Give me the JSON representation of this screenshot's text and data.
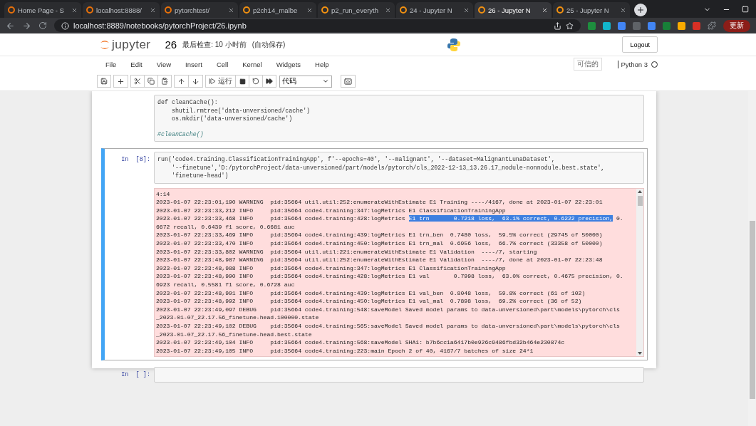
{
  "browser": {
    "tabs": [
      {
        "title": "Home Page - S",
        "selected": false
      },
      {
        "title": "localhost:8888/",
        "selected": false
      },
      {
        "title": "pytorchtest/",
        "selected": false
      },
      {
        "title": "p2ch14_malbe",
        "selected": false
      },
      {
        "title": "p2_run_everyth",
        "selected": false
      },
      {
        "title": "24 - Jupyter N",
        "selected": false
      },
      {
        "title": "26 - Jupyter N",
        "selected": true
      },
      {
        "title": "25 - Jupyter N",
        "selected": false
      }
    ],
    "url": "localhost:8889/notebooks/pytorchProject/26.ipynb",
    "update_button": "更新"
  },
  "header": {
    "logo": "jupyter",
    "notebook_name": "26",
    "checkpoint": "最后检查: 10 小时前",
    "autosave": "(自动保存)",
    "logout": "Logout"
  },
  "menu": [
    "File",
    "Edit",
    "View",
    "Insert",
    "Cell",
    "Kernel",
    "Widgets",
    "Help"
  ],
  "trusted": "可信的",
  "kernel": {
    "name": "Python 3",
    "busy": false
  },
  "toolbar": {
    "run_label": "运行",
    "cell_type": "代码"
  },
  "cells": [
    {
      "selected": false,
      "code": [
        {
          "text": "def cleanCache():",
          "kind": "code"
        },
        {
          "text": "    shutil.rmtree('data-unversioned/cache')",
          "kind": "code"
        },
        {
          "text": "    os.mkdir('data-unversioned/cache')",
          "kind": "code"
        },
        {
          "text": "#cleanCache()",
          "kind": "comment"
        }
      ]
    },
    {
      "prompt": "In  [8]:",
      "selected": true,
      "code": [
        {
          "text": "run('code4.training.ClassificationTrainingApp', f'--epochs=40', '--malignant', '--dataset=MalignantLunaDataset',",
          "kind": "code"
        },
        {
          "text": "    '--finetune','D:/pytorchProject/data-unversioned/part/models/pytorch/cls_2022-12-13_13.26.17_nodule-nonnodule.best.state',",
          "kind": "code"
        },
        {
          "text": "    'finetune-head')",
          "kind": "code"
        }
      ],
      "output": [
        {
          "parts": [
            {
              "text": "4:14",
              "selected": false
            }
          ]
        },
        {
          "parts": [
            {
              "text": "2023-01-07 22:23:01,190 WARNING  pid:35664 util.util:252:enumerateWithEstimate E1 Training ----/4167, done at 2023-01-07 22:23:01",
              "selected": false
            }
          ]
        },
        {
          "parts": [
            {
              "text": "2023-01-07 22:23:33,212 INFO     pid:35664 code4.training:347:logMetrics E1 ClassificationTrainingApp",
              "selected": false
            }
          ]
        },
        {
          "parts": [
            {
              "text": "2023-01-07 22:23:33,468 INFO     pid:35664 code4.training:428:logMetrics ",
              "selected": false
            },
            {
              "text": "E1 trn       0.7218 loss,  63.1% correct, 0.6222 precision,",
              "selected": true
            },
            {
              "text": " 0.",
              "selected": false
            }
          ]
        },
        {
          "parts": [
            {
              "text": "6672 recall, 0.6439 f1 score, 0.6681 auc",
              "selected": false
            }
          ]
        },
        {
          "parts": [
            {
              "text": "2023-01-07 22:23:33,469 INFO     pid:35664 code4.training:439:logMetrics E1 trn_ben  0.7480 loss,  59.5% correct (29745 of 50000)",
              "selected": false
            }
          ]
        },
        {
          "parts": [
            {
              "text": "2023-01-07 22:23:33,470 INFO     pid:35664 code4.training:450:logMetrics E1 trn_mal  0.6956 loss,  66.7% correct (33358 of 50000)",
              "selected": false
            }
          ]
        },
        {
          "parts": [
            {
              "text": "2023-01-07 22:23:33,802 WARNING  pid:35664 util.util:221:enumerateWithEstimate E1 Validation  ----/7, starting",
              "selected": false
            }
          ]
        },
        {
          "parts": [
            {
              "text": "2023-01-07 22:23:48,987 WARNING  pid:35664 util.util:252:enumerateWithEstimate E1 Validation  ----/7, done at 2023-01-07 22:23:48",
              "selected": false
            }
          ]
        },
        {
          "parts": [
            {
              "text": "2023-01-07 22:23:48,988 INFO     pid:35664 code4.training:347:logMetrics E1 ClassificationTrainingApp",
              "selected": false
            }
          ]
        },
        {
          "parts": [
            {
              "text": "2023-01-07 22:23:48,990 INFO     pid:35664 code4.training:428:logMetrics E1 val       0.7998 loss,  63.0% correct, 0.4675 precision, 0.",
              "selected": false
            }
          ]
        },
        {
          "parts": [
            {
              "text": "6923 recall, 0.5581 f1 score, 0.6728 auc",
              "selected": false
            }
          ]
        },
        {
          "parts": [
            {
              "text": "2023-01-07 22:23:48,991 INFO     pid:35664 code4.training:439:logMetrics E1 val_ben  0.8048 loss,  59.8% correct (61 of 102)",
              "selected": false
            }
          ]
        },
        {
          "parts": [
            {
              "text": "2023-01-07 22:23:48,992 INFO     pid:35664 code4.training:450:logMetrics E1 val_mal  0.7898 loss,  69.2% correct (36 of 52)",
              "selected": false
            }
          ]
        },
        {
          "parts": [
            {
              "text": "2023-01-07 22:23:49,097 DEBUG    pid:35664 code4.training:548:saveModel Saved model params to data-unversioned\\part\\models\\pytorch\\cls",
              "selected": false
            }
          ]
        },
        {
          "parts": [
            {
              "text": "_2023-01-07_22.17.56_finetune-head.100000.state",
              "selected": false
            }
          ]
        },
        {
          "parts": [
            {
              "text": "2023-01-07 22:23:49,102 DEBUG    pid:35664 code4.training:565:saveModel Saved model params to data-unversioned\\part\\models\\pytorch\\cls",
              "selected": false
            }
          ]
        },
        {
          "parts": [
            {
              "text": "_2023-01-07_22.17.56_finetune-head.best.state",
              "selected": false
            }
          ]
        },
        {
          "parts": [
            {
              "text": "2023-01-07 22:23:49,104 INFO     pid:35664 code4.training:568:saveModel SHA1: b7b6cc1a6417b0e926c9486fbd32b464e230874c",
              "selected": false
            }
          ]
        },
        {
          "parts": [
            {
              "text": "2023-01-07 22:23:49,105 INFO     pid:35664 code4.training:223:main Epoch 2 of 40, 4167/7 batches of size 24*1",
              "selected": false
            }
          ]
        }
      ]
    },
    {
      "prompt": "In  [ ]:",
      "selected": false
    }
  ]
}
